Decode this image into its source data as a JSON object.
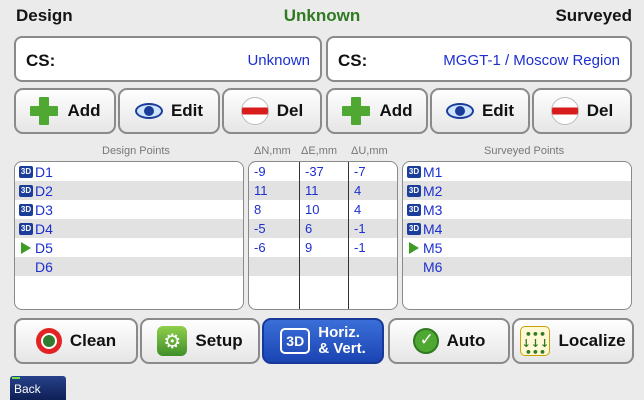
{
  "header": {
    "left": "Design",
    "center": "Unknown",
    "right": "Surveyed"
  },
  "cs_left": {
    "label": "CS:",
    "value": "Unknown"
  },
  "cs_right": {
    "label": "CS:",
    "value": "MGGT-1 / Moscow Region"
  },
  "toolbar_left": {
    "add": "Add",
    "edit": "Edit",
    "del": "Del"
  },
  "toolbar_right": {
    "add": "Add",
    "edit": "Edit",
    "del": "Del"
  },
  "captions": {
    "design": "Design Points",
    "dn": "ΔN,mm",
    "de": "ΔE,mm",
    "du": "ΔU,mm",
    "surveyed": "Surveyed Points"
  },
  "design_points": [
    {
      "name": "D1",
      "icon": "3d-badge"
    },
    {
      "name": "D2",
      "icon": "3d-badge"
    },
    {
      "name": "D3",
      "icon": "3d-badge"
    },
    {
      "name": "D4",
      "icon": "3d-badge"
    },
    {
      "name": "D5",
      "icon": "arrow-right"
    },
    {
      "name": "D6",
      "icon": "none"
    }
  ],
  "deltas": [
    {
      "dn": "-9",
      "de": "-37",
      "du": "-7"
    },
    {
      "dn": "11",
      "de": "11",
      "du": "4"
    },
    {
      "dn": "8",
      "de": "10",
      "du": "4"
    },
    {
      "dn": "-5",
      "de": "6",
      "du": "-1"
    },
    {
      "dn": "-6",
      "de": "9",
      "du": "-1"
    }
  ],
  "surveyed_points": [
    {
      "name": "M1",
      "icon": "3d-badge"
    },
    {
      "name": "M2",
      "icon": "3d-badge"
    },
    {
      "name": "M3",
      "icon": "3d-badge"
    },
    {
      "name": "M4",
      "icon": "3d-badge"
    },
    {
      "name": "M5",
      "icon": "arrow-right"
    },
    {
      "name": "M6",
      "icon": "none"
    }
  ],
  "bottom": {
    "clean": "Clean",
    "setup": "Setup",
    "hv_icon": "3D",
    "hv_line1": "Horiz.",
    "hv_line2": "& Vert.",
    "auto": "Auto",
    "localize": "Localize"
  },
  "back": "Back",
  "colors": {
    "accent": "#1c2fd0",
    "header_center": "#2f7a22",
    "active_button": "#1b44b3"
  }
}
